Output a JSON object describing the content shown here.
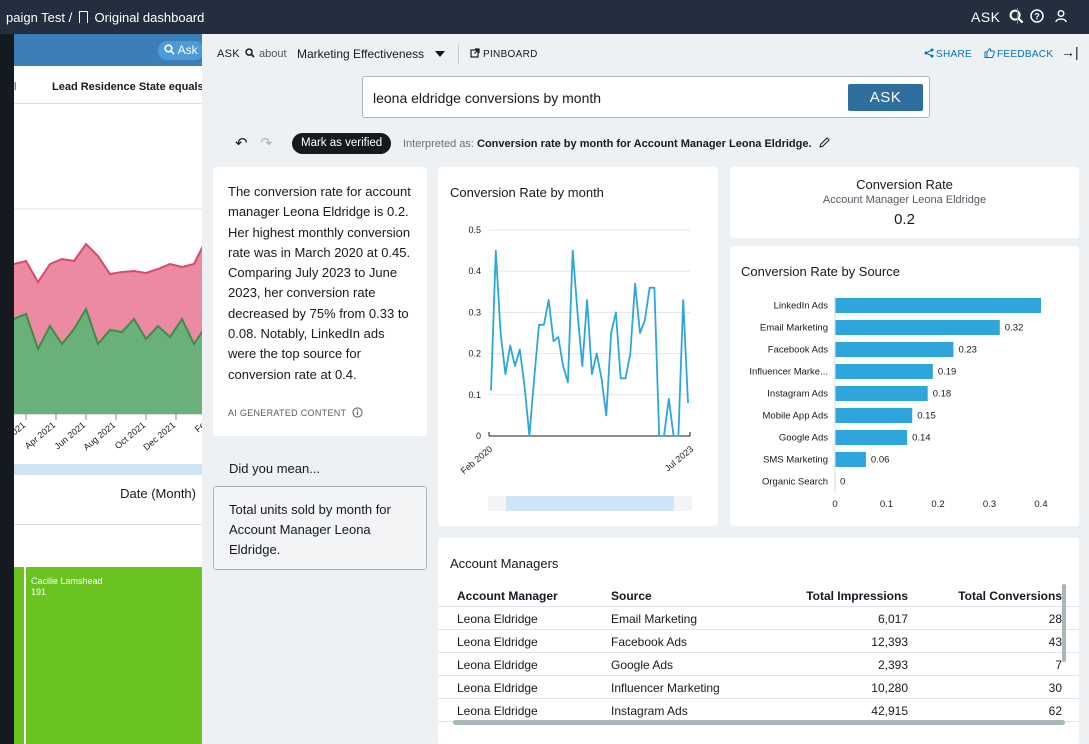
{
  "topbar": {
    "breadcrumb_prefix": "paign Test /",
    "breadcrumb_dashboard": "Original dashboard",
    "ask_label": "ASK",
    "help_icon": "help-circle-icon",
    "user_icon": "user-icon"
  },
  "dashboard": {
    "ask_label": "Ask",
    "filter_left": "l",
    "filter_label": "Lead Residence State equals",
    "x_axis_ticks": [
      "eb 2021",
      "Apr 2021",
      "Jun 2021",
      "Aug 2021",
      "Oct 2021",
      "Dec 2021",
      "Fe"
    ],
    "x_axis_title": "Date (Month)",
    "treemap_name": "Cacilie Lamshead",
    "treemap_value": "191",
    "colors": {
      "pink": "#e8758f",
      "green": "#6ab07a",
      "treemap": "#6ac321"
    }
  },
  "qpanel": {
    "ask_label": "ASK",
    "about_label": "about",
    "topic": "Marketing Effectiveness",
    "pinboard_label": "PINBOARD",
    "share_label": "SHARE",
    "feedback_label": "FEEDBACK",
    "search_value": "leona eldridge conversions by month",
    "ask_button": "ASK",
    "verify_label": "Mark as verified",
    "interpreted_prefix": "Interpreted as:",
    "interpreted_text": "Conversion rate by month for Account Manager Leona Eldridge.",
    "summary_text": "The conversion rate for account manager Leona Eldridge is 0.2. Her highest monthly conversion rate was in March 2020 at 0.45. Comparing July 2023 to June 2023, her conversion rate decreased by 75% from 0.33 to 0.08. Notably, LinkedIn ads were the top source for conversion rate at 0.4.",
    "ai_label": "AI GENERATED CONTENT",
    "did_you_mean": "Did you mean...",
    "suggestion": "Total units sold by month for Account Manager Leona Eldridge."
  },
  "kpi": {
    "title": "Conversion Rate",
    "subtitle": "Account Manager Leona Eldridge",
    "value": "0.2"
  },
  "chart_data": [
    {
      "type": "line",
      "title": "Conversion Rate by month",
      "x_start": "Feb 2020",
      "x_end": "Jul 2023",
      "x_tick_labels": [
        "Feb 2020",
        "Jul 2023"
      ],
      "y_ticks": [
        "0",
        "0.1",
        "0.2",
        "0.3",
        "0.4",
        "0.5"
      ],
      "ylim": [
        0,
        0.5
      ],
      "color": "#2ea6dc",
      "values": [
        0.11,
        0.45,
        0.25,
        0.15,
        0.22,
        0.17,
        0.21,
        0.12,
        0.0,
        0.14,
        0.27,
        0.27,
        0.33,
        0.23,
        0.24,
        0.17,
        0.13,
        0.45,
        0.3,
        0.17,
        0.33,
        0.15,
        0.2,
        0.14,
        0.05,
        0.25,
        0.3,
        0.14,
        0.14,
        0.2,
        0.37,
        0.25,
        0.28,
        0.36,
        0.36,
        0.0,
        0.0,
        0.09,
        0.0,
        0.0,
        0.33,
        0.08
      ]
    },
    {
      "type": "bar",
      "orientation": "horizontal",
      "title": "Conversion Rate by Source",
      "categories": [
        "LinkedIn Ads",
        "Email Marketing",
        "Facebook Ads",
        "Influencer Marke...",
        "Instagram Ads",
        "Mobile App Ads",
        "Google Ads",
        "SMS Marketing",
        "Organic Search"
      ],
      "values": [
        0.4,
        0.32,
        0.23,
        0.19,
        0.18,
        0.15,
        0.14,
        0.06,
        0
      ],
      "value_labels": [
        "",
        "0.32",
        "0.23",
        "0.19",
        "0.18",
        "0.15",
        "0.14",
        "0.06",
        "0"
      ],
      "x_ticks": [
        "0",
        "0.1",
        "0.2",
        "0.3",
        "0.4"
      ],
      "xlim": [
        0,
        0.4
      ],
      "color": "#2ea6dc"
    }
  ],
  "table": {
    "title": "Account Managers",
    "columns": [
      "Account Manager",
      "Source",
      "Total Impressions",
      "Total Conversions"
    ],
    "rows": [
      [
        "Leona Eldridge",
        "Email Marketing",
        "6,017",
        "28"
      ],
      [
        "Leona Eldridge",
        "Facebook Ads",
        "12,393",
        "43"
      ],
      [
        "Leona Eldridge",
        "Google Ads",
        "2,393",
        "7"
      ],
      [
        "Leona Eldridge",
        "Influencer Marketing",
        "10,280",
        "30"
      ],
      [
        "Leona Eldridge",
        "Instagram Ads",
        "42,915",
        "62"
      ]
    ]
  }
}
